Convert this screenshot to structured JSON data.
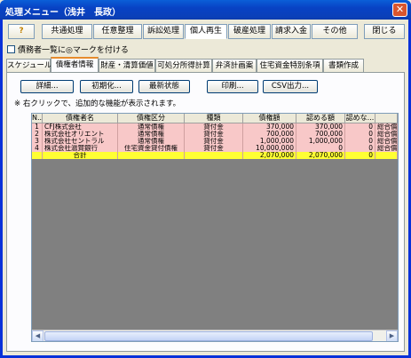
{
  "window": {
    "title": "処理メニュー（浅井　長政）",
    "close_glyph": "✕"
  },
  "menu": {
    "help_glyph": "?",
    "items": [
      "共通処理",
      "任意整理",
      "訴訟処理",
      "個人再生",
      "破産処理",
      "請求入金",
      "その他"
    ],
    "close_label": "閉じる"
  },
  "checkbox": {
    "label": "債務者一覧に◎マークを付ける",
    "checked": false
  },
  "tabs": [
    "スケジュール",
    "債権者情報",
    "財産・清算価値",
    "可処分所得計算",
    "弁済計画案",
    "住宅資金特別条項",
    "書類作成"
  ],
  "active_tab": "債権者情報",
  "actions": {
    "detail": "詳細...",
    "init": "初期化...",
    "latest": "最新状態",
    "print": "印刷...",
    "csv": "CSV出力..."
  },
  "note": "※ 右クリックで、追加的な機能が表示されます。",
  "table": {
    "columns": [
      "N..",
      "債権者名",
      "債権区分",
      "種類",
      "債権額",
      "認める額",
      "認めな..."
    ],
    "rows": [
      {
        "no": "1",
        "name": "CFJ株式会社",
        "category": "通常債権",
        "kind": "貸付金",
        "amount": "370,000",
        "admitted": "370,000",
        "not_admitted": "0",
        "extra": "総合償"
      },
      {
        "no": "2",
        "name": "株式会社オリエント",
        "category": "通常債権",
        "kind": "貸付金",
        "amount": "700,000",
        "admitted": "700,000",
        "not_admitted": "0",
        "extra": "総合償"
      },
      {
        "no": "3",
        "name": "株式会社セントラル",
        "category": "通常債権",
        "kind": "貸付金",
        "amount": "1,000,000",
        "admitted": "1,000,000",
        "not_admitted": "0",
        "extra": "総合償"
      },
      {
        "no": "4",
        "name": "株式会社滋賀銀行",
        "category": "住宅資金貸付債権",
        "kind": "貸付金",
        "amount": "10,000,000",
        "admitted": "0",
        "not_admitted": "0",
        "extra": "総合償"
      }
    ],
    "total": {
      "label": "合計",
      "amount": "2,070,000",
      "admitted": "2,070,000",
      "not_admitted": "0"
    }
  },
  "scroll": {
    "left": "◀",
    "right": "▶"
  }
}
